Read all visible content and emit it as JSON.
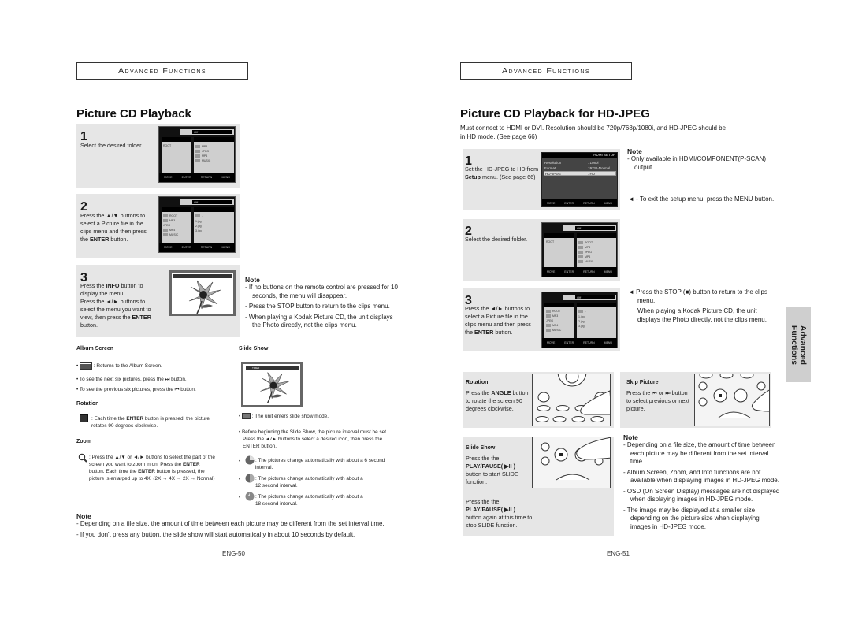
{
  "left_page": {
    "section_header": "Advanced Functions",
    "title": "Picture CD Playback",
    "steps": [
      {
        "number": "1",
        "text": "Select the desired folder."
      },
      {
        "number": "2",
        "text_parts": [
          "Press the ▲/▼ buttons to select a Picture file in the clips menu and then press the ",
          "ENTER",
          " button."
        ]
      },
      {
        "number": "3",
        "text_parts": [
          "Press the ",
          "INFO",
          " button to display the menu.",
          "Press the ◄/► buttons to select the menu you want to view, then press the ",
          "ENTER",
          " button."
        ]
      }
    ],
    "osd_screens": {
      "top_tab_label": "Off",
      "folder_items": [
        "ROOT",
        "MP3",
        "JPEG",
        "MP4",
        "MUSIC"
      ],
      "file_items": [
        "..",
        "1.jpg",
        "2.jpg",
        "3.jpg"
      ],
      "footer": [
        "MOVE",
        "ENTER",
        "RETURN",
        "MENU"
      ]
    },
    "step3_note": {
      "heading": "Note",
      "items": [
        "If no buttons on the remote control are pressed for 10 seconds, the menu will disappear.",
        "Press the STOP button to return to the clips menu.",
        "When playing a Kodak Picture CD, the unit displays the Photo directly, not the clips menu."
      ]
    },
    "album_screen": {
      "heading": "Album Screen",
      "items": [
        ": Returns to the Album Screen.",
        "To see the next six pictures, press the ⏭ button.",
        "To see the previous six pictures, press the ⏮ button."
      ]
    },
    "rotation": {
      "heading": "Rotation",
      "text_parts": [
        ": Each time the ",
        "ENTER",
        " button is pressed, the picture rotates 90 degrees clockwise."
      ]
    },
    "zoom": {
      "heading": "Zoom",
      "text_parts": [
        ": Press the ▲/▼ or ◄/► buttons to select the part of the screen you want to zoom in on. Press the ",
        "ENTER",
        " button. Each time the ",
        "ENTER",
        " button is pressed, the picture is enlarged up to 4X. (2X → 4X → 2X → Normal)"
      ]
    },
    "slide_show": {
      "heading": "Slide Show",
      "items": [
        ": The unit enters slide show mode.",
        "Before beginning the Slide Show, the picture interval must be set. Press the ◄/► buttons to select a desired icon, then press the ENTER button.",
        ": The pictures change automatically with about a 6 second interval.",
        ": The pictures change automatically with about a 12 second interval.",
        ": The pictures change automatically with about a 18 second interval."
      ],
      "osd_label": "TIMER"
    },
    "bottom_note": {
      "heading": "Note",
      "items": [
        "Depending on a file size, the amount of time between each picture may be different from the set interval time.",
        "If you don't press any button, the slide show will start automatically in about 10 seconds by default."
      ]
    },
    "page_number": "ENG-50"
  },
  "right_page": {
    "section_header": "Advanced Functions",
    "title": "Picture CD Playback for HD-JPEG",
    "intro": "Must connect to HDMI or DVI. Resolution should be 720p/768p/1080i, and HD-JPEG should be in HD mode. (See page 66)",
    "steps": [
      {
        "number": "1",
        "text_parts": [
          "Set the HD-JPEG to HD from ",
          "Setup",
          " menu. (See page 66)"
        ]
      },
      {
        "number": "2",
        "text": "Select the desired folder."
      },
      {
        "number": "3",
        "text_parts": [
          "Press the ◄/► buttons to select a Picture file in the clips menu and then press the ",
          "ENTER",
          " button."
        ]
      }
    ],
    "hdmi_setup_osd": {
      "title": "HDMI SETUP",
      "rows": [
        {
          "label": "Resolution",
          "value": ": 1080i"
        },
        {
          "label": "Format",
          "value": ": RGB-Normal"
        },
        {
          "label": "HD-JPEG",
          "value": ": HD"
        }
      ],
      "footer": [
        "MOVE",
        "ENTER",
        "RETURN",
        "MENU"
      ]
    },
    "step1_note": {
      "heading": "Note",
      "items": [
        "Only available in HDMI/COMPONENT(P-SCAN) output."
      ],
      "exit_tip": "- To exit the setup menu, press the MENU button."
    },
    "step3_tip": {
      "line1": "Press the STOP (■) button to return to the clips menu.",
      "line2": "When playing a Kodak Picture CD, the unit displays the Photo directly, not the clips menu."
    },
    "rotation": {
      "heading": "Rotation",
      "text_parts": [
        "Press the ",
        "ANGLE",
        " button to rotate the screen 90 degrees clockwise."
      ]
    },
    "skip_picture": {
      "heading": "Skip Picture",
      "text": "Press the ⏮ or ⏭ button to select previous or next picture."
    },
    "slide_show": {
      "heading": "Slide Show",
      "start_parts": [
        "Press the the ",
        "PLAY/PAUSE( ▶II )",
        " button to start SLIDE function."
      ],
      "stop_parts": [
        "Press the the ",
        "PLAY/PAUSE( ▶II )",
        " button again at this time to stop SLIDE function."
      ]
    },
    "note": {
      "heading": "Note",
      "items": [
        "Depending on a file size, the amount of time between each picture may be different from the set interval time.",
        "Album Screen, Zoom, and Info functions are not available when displaying images in HD-JPEG mode.",
        "OSD (On Screen Display) messages are not displayed when displaying images in HD-JPEG mode.",
        "The image may be displayed at a smaller size depending on the picture size when displaying images in HD-JPEG mode."
      ]
    },
    "side_tab": {
      "line1": "Advanced",
      "line2": "Functions"
    },
    "page_number": "ENG-51"
  }
}
